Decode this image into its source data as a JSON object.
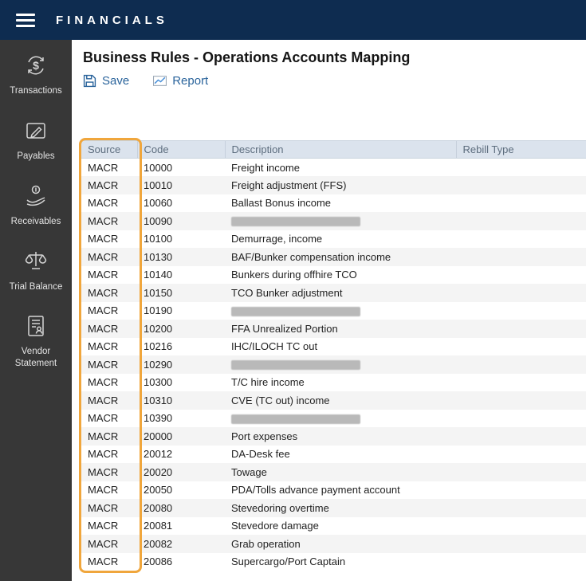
{
  "topbar": {
    "title": "FINANCIALS"
  },
  "sidebar": {
    "items": [
      {
        "label": "Transactions",
        "icon": "transactions-icon"
      },
      {
        "label": "Payables",
        "icon": "payables-icon"
      },
      {
        "label": "Receivables",
        "icon": "receivables-icon"
      },
      {
        "label": "Trial Balance",
        "icon": "trial-balance-icon"
      },
      {
        "label": "Vendor Statement",
        "icon": "vendor-statement-icon"
      }
    ]
  },
  "main": {
    "title": "Business Rules - Operations Accounts Mapping",
    "toolbar": {
      "save_label": "Save",
      "report_label": "Report"
    }
  },
  "table": {
    "columns": [
      "Source",
      "Code",
      "Description",
      "Rebill Type"
    ],
    "rows": [
      {
        "source": "MACR",
        "code": "10000",
        "description": "Freight income",
        "rebill": "",
        "redacted": false
      },
      {
        "source": "MACR",
        "code": "10010",
        "description": "Freight adjustment (FFS)",
        "rebill": "",
        "redacted": false
      },
      {
        "source": "MACR",
        "code": "10060",
        "description": "Ballast Bonus income",
        "rebill": "",
        "redacted": false
      },
      {
        "source": "MACR",
        "code": "10090",
        "description": "",
        "rebill": "",
        "redacted": true
      },
      {
        "source": "MACR",
        "code": "10100",
        "description": "Demurrage, income",
        "rebill": "",
        "redacted": false
      },
      {
        "source": "MACR",
        "code": "10130",
        "description": "BAF/Bunker compensation income",
        "rebill": "",
        "redacted": false
      },
      {
        "source": "MACR",
        "code": "10140",
        "description": "Bunkers during offhire TCO",
        "rebill": "",
        "redacted": false
      },
      {
        "source": "MACR",
        "code": "10150",
        "description": "TCO Bunker adjustment",
        "rebill": "",
        "redacted": false
      },
      {
        "source": "MACR",
        "code": "10190",
        "description": "",
        "rebill": "",
        "redacted": true
      },
      {
        "source": "MACR",
        "code": "10200",
        "description": "FFA Unrealized Portion",
        "rebill": "",
        "redacted": false
      },
      {
        "source": "MACR",
        "code": "10216",
        "description": "IHC/ILOCH TC out",
        "rebill": "",
        "redacted": false
      },
      {
        "source": "MACR",
        "code": "10290",
        "description": "",
        "rebill": "",
        "redacted": true
      },
      {
        "source": "MACR",
        "code": "10300",
        "description": "T/C hire income",
        "rebill": "",
        "redacted": false
      },
      {
        "source": "MACR",
        "code": "10310",
        "description": "CVE (TC out) income",
        "rebill": "",
        "redacted": false
      },
      {
        "source": "MACR",
        "code": "10390",
        "description": "",
        "rebill": "",
        "redacted": true
      },
      {
        "source": "MACR",
        "code": "20000",
        "description": "Port expenses",
        "rebill": "",
        "redacted": false
      },
      {
        "source": "MACR",
        "code": "20012",
        "description": "DA-Desk fee",
        "rebill": "",
        "redacted": false
      },
      {
        "source": "MACR",
        "code": "20020",
        "description": "Towage",
        "rebill": "",
        "redacted": false
      },
      {
        "source": "MACR",
        "code": "20050",
        "description": "PDA/Tolls advance payment account",
        "rebill": "",
        "redacted": false
      },
      {
        "source": "MACR",
        "code": "20080",
        "description": "Stevedoring overtime",
        "rebill": "",
        "redacted": false
      },
      {
        "source": "MACR",
        "code": "20081",
        "description": "Stevedore damage",
        "rebill": "",
        "redacted": false
      },
      {
        "source": "MACR",
        "code": "20082",
        "description": "Grab operation",
        "rebill": "",
        "redacted": false
      },
      {
        "source": "MACR",
        "code": "20086",
        "description": "Supercargo/Port Captain",
        "rebill": "",
        "redacted": false
      }
    ]
  },
  "colors": {
    "topbar_bg": "#0e2c50",
    "sidebar_bg": "#373737",
    "header_bg": "#dbe3ed",
    "link_blue": "#29639b",
    "highlight_orange": "#f0a63c"
  }
}
